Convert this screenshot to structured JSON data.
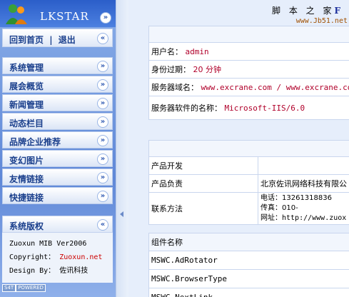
{
  "sidebar": {
    "logo_text": "LKSTAR",
    "home_link": "回到首页",
    "separator": "|",
    "logout_link": "退出",
    "collapse_glyph": "«",
    "expand_glyph": "»",
    "nav_items": [
      {
        "label": "系统管理"
      },
      {
        "label": "展会概览"
      },
      {
        "label": "新闻管理"
      },
      {
        "label": "动态栏目"
      },
      {
        "label": "品牌企业推荐"
      },
      {
        "label": "变幻图片"
      },
      {
        "label": "友情链接"
      },
      {
        "label": "快捷链接"
      }
    ],
    "copyright": {
      "title": "系统版权",
      "line1": "Zuoxun MIB Ver2006",
      "line2_label": "Copyright：",
      "line2_value": "Zuoxun.net",
      "line3_label": "Design By：",
      "line3_value": "佐讯科技"
    },
    "badge": [
      "S4T",
      "POWERED"
    ]
  },
  "watermark": {
    "chars": "脚 本 之 家",
    "logo_letter": "F",
    "url": "www.Jb51.net"
  },
  "server_info": {
    "rows": [
      {
        "label": "用户名：",
        "value": "admin"
      },
      {
        "label": "身份过期：",
        "value": "20 分钟"
      },
      {
        "label": "服务器域名：",
        "value": "www.excrane.com / www.excrane.com"
      },
      {
        "label": "服务器软件的名称：",
        "value": "Microsoft-IIS/6.0"
      }
    ]
  },
  "product_info": {
    "rows": [
      {
        "label": "产品开发",
        "value": ""
      },
      {
        "label": "产品负责",
        "value": "北京佐讯网络科技有限公"
      },
      {
        "label": "联系方法",
        "lines": [
          "电话：13261318836",
          "传真：010-",
          "网址：http://www.zuox"
        ]
      }
    ]
  },
  "components": {
    "header": "组件名称",
    "rows": [
      "MSWC.AdRotator",
      "MSWC.BrowserType",
      "MSWC.NextLink"
    ]
  },
  "colors": {
    "sidebar_blue": "#5f88d8",
    "accent_red": "#cc0000",
    "nav_text": "#1a3f8c"
  }
}
